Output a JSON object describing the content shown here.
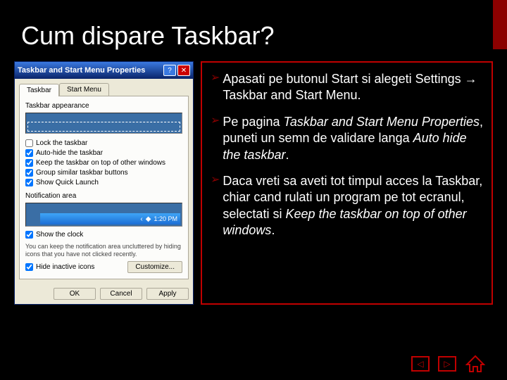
{
  "slide": {
    "title": "Cum dispare Taskbar?"
  },
  "dialog": {
    "title": "Taskbar and Start Menu Properties",
    "tabs": {
      "taskbar": "Taskbar",
      "startmenu": "Start Menu"
    },
    "appearance_label": "Taskbar appearance",
    "checks": {
      "lock": "Lock the taskbar",
      "autohide": "Auto-hide the taskbar",
      "ontop": "Keep the taskbar on top of other windows",
      "group": "Group similar taskbar buttons",
      "quicklaunch": "Show Quick Launch"
    },
    "notif_label": "Notification area",
    "notif_time": "1:20 PM",
    "showclock": "Show the clock",
    "hint": "You can keep the notification area uncluttered by hiding icons that you have not clicked recently.",
    "hideinactive": "Hide inactive icons",
    "customize": "Customize...",
    "ok": "OK",
    "cancel": "Cancel",
    "apply": "Apply"
  },
  "bullets": {
    "b1a": "Apasati pe butonul Start si alegeti Settings ",
    "b1b": " Taskbar and Start Menu.",
    "b2a": "Pe pagina ",
    "b2b": "Taskbar and Start Menu Properties",
    "b2c": ", puneti un semn de validare langa ",
    "b2d": "Auto hide the taskbar",
    "b2e": ".",
    "b3a": "Daca vreti sa aveti tot timpul acces la Taskbar, chiar cand rulati un program pe tot ecranul, selectati si ",
    "b3b": "Keep the taskbar on top of other windows",
    "b3c": "."
  },
  "arrow": "→"
}
